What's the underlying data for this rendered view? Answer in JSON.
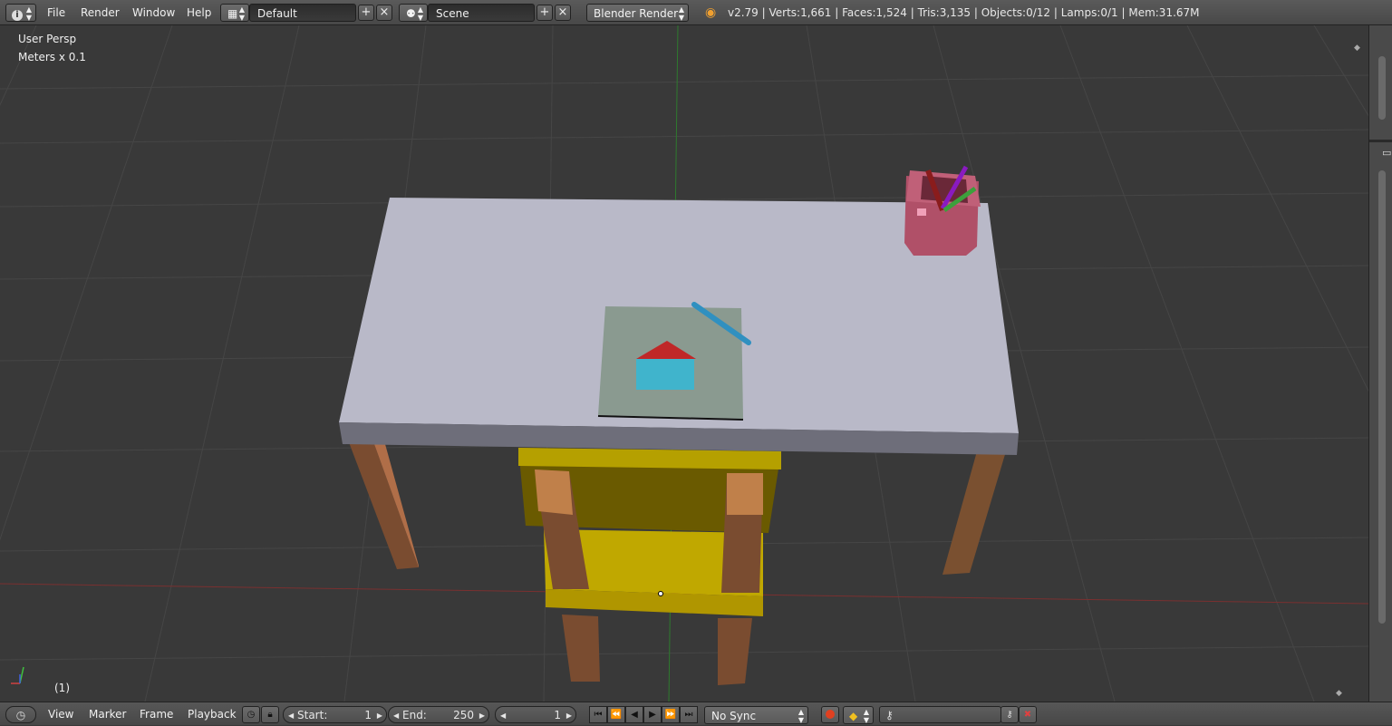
{
  "menubar": {
    "info_icon": "info-icon",
    "items": [
      "File",
      "Render",
      "Window",
      "Help"
    ],
    "layout_value": "Default",
    "scene_value": "Scene",
    "render_engine": "Blender Render",
    "stats": "v2.79 | Verts:1,661 | Faces:1,524 | Tris:3,135 | Objects:0/12 | Lamps:0/1 | Mem:31.67M"
  },
  "viewport": {
    "view_name": "User Persp",
    "units": "Meters x 0.1",
    "frame_indicator": "(1)"
  },
  "timeline": {
    "items": [
      "View",
      "Marker",
      "Frame",
      "Playback"
    ],
    "start_label": "Start:",
    "start_value": "1",
    "end_label": "End:",
    "end_value": "250",
    "current_frame": "1",
    "sync_mode": "No Sync"
  },
  "colors": {
    "viewport_bg": "#393939",
    "grid_line": "#4a4a4a",
    "x_axis": "#8a3a3a",
    "y_axis": "#3a8a3a",
    "desk_top": "#b8b8c8",
    "desk_front": "#6e6e7a",
    "leg": "#8a5a3a",
    "chair": "#b8a000",
    "paper": "#8a9a90",
    "house_wall": "#40b0c8",
    "house_roof": "#c83030",
    "cup": "#a04860"
  }
}
